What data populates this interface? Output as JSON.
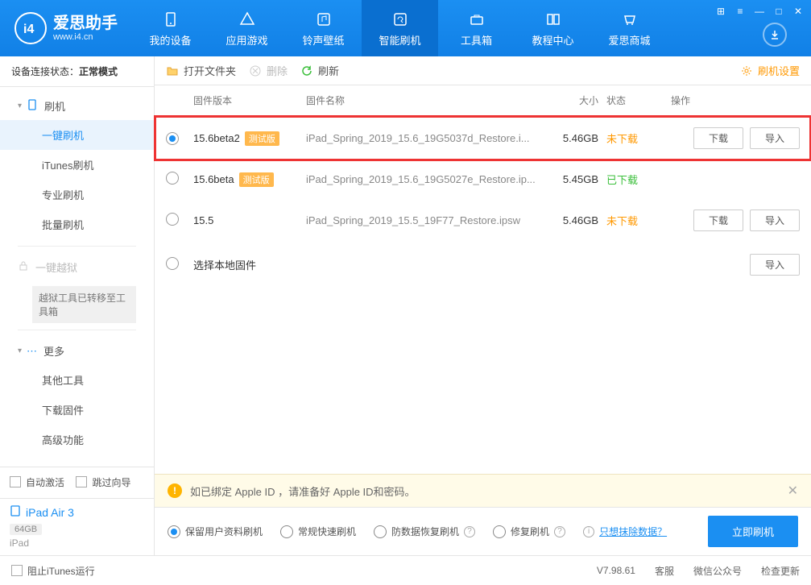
{
  "app": {
    "name": "爱思助手",
    "url": "www.i4.cn"
  },
  "nav": [
    {
      "label": "我的设备"
    },
    {
      "label": "应用游戏"
    },
    {
      "label": "铃声壁纸"
    },
    {
      "label": "智能刷机"
    },
    {
      "label": "工具箱"
    },
    {
      "label": "教程中心"
    },
    {
      "label": "爱思商城"
    }
  ],
  "status": {
    "label": "设备连接状态：",
    "value": "正常模式"
  },
  "sidebar": {
    "flash": {
      "head": "刷机",
      "items": [
        "一键刷机",
        "iTunes刷机",
        "专业刷机",
        "批量刷机"
      ]
    },
    "jailbreak": {
      "head": "一键越狱",
      "note": "越狱工具已转移至工具箱"
    },
    "more": {
      "head": "更多",
      "items": [
        "其他工具",
        "下载固件",
        "高级功能"
      ]
    }
  },
  "checks": {
    "autoActivate": "自动激活",
    "skipGuide": "跳过向导",
    "blockItunes": "阻止iTunes运行"
  },
  "device": {
    "name": "iPad Air 3",
    "storage": "64GB",
    "type": "iPad"
  },
  "toolbar": {
    "open": "打开文件夹",
    "delete": "删除",
    "refresh": "刷新",
    "settings": "刷机设置"
  },
  "thead": {
    "ver": "固件版本",
    "name": "固件名称",
    "size": "大小",
    "status": "状态",
    "ops": "操作"
  },
  "rows": [
    {
      "version": "15.6beta2",
      "beta": "测试版",
      "name": "iPad_Spring_2019_15.6_19G5037d_Restore.i...",
      "size": "5.46GB",
      "status": "未下载",
      "statusClass": "st-orange",
      "selected": true,
      "showOps": true
    },
    {
      "version": "15.6beta",
      "beta": "测试版",
      "name": "iPad_Spring_2019_15.6_19G5027e_Restore.ip...",
      "size": "5.45GB",
      "status": "已下载",
      "statusClass": "st-green",
      "selected": false,
      "showOps": false
    },
    {
      "version": "15.5",
      "beta": "",
      "name": "iPad_Spring_2019_15.5_19F77_Restore.ipsw",
      "size": "5.46GB",
      "status": "未下载",
      "statusClass": "st-orange",
      "selected": false,
      "showOps": true
    }
  ],
  "localRow": {
    "label": "选择本地固件",
    "importBtn": "导入"
  },
  "buttons": {
    "download": "下载",
    "import": "导入"
  },
  "notice": "如已绑定 Apple ID ，请准备好 Apple ID和密码。",
  "options": {
    "items": [
      "保留用户资料刷机",
      "常规快速刷机",
      "防数据恢复刷机",
      "修复刷机"
    ],
    "eraseLink": "只想抹除数据？",
    "go": "立即刷机"
  },
  "footer": {
    "version": "V7.98.61",
    "service": "客服",
    "wechat": "微信公众号",
    "update": "检查更新"
  }
}
